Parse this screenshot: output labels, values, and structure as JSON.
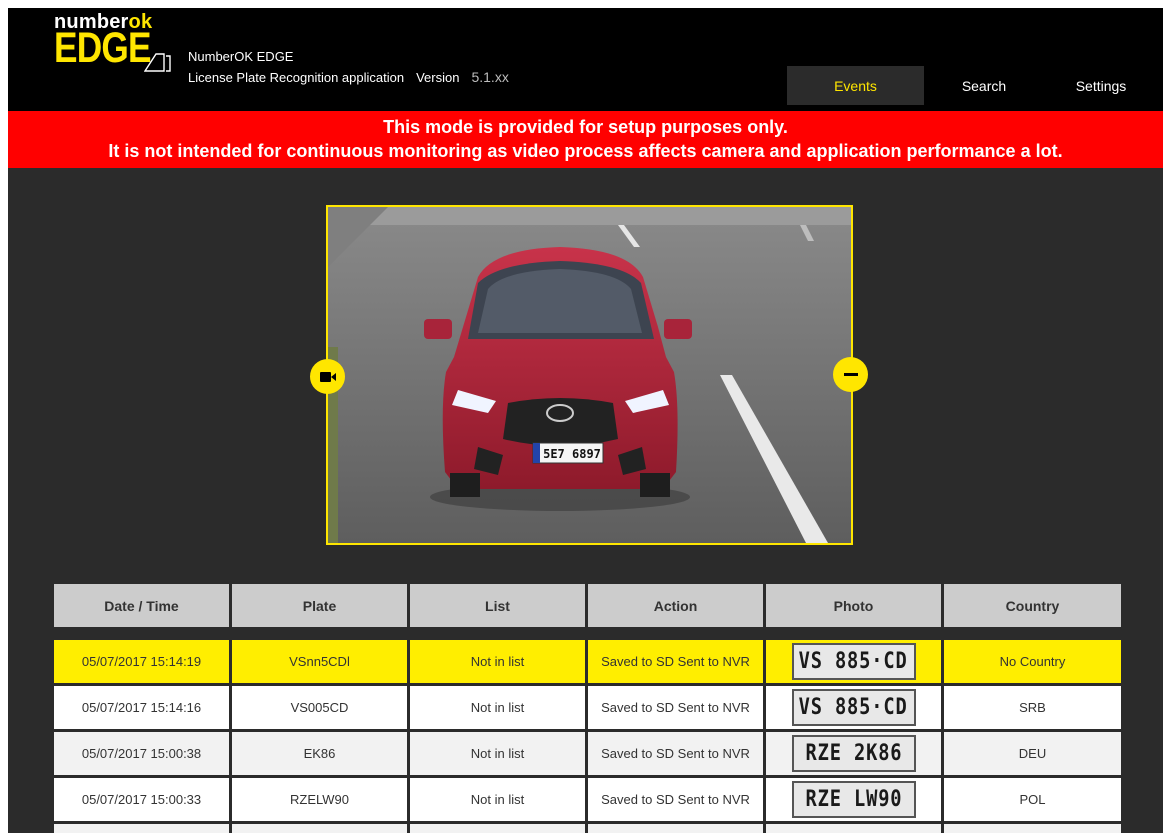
{
  "header": {
    "logo_word": "number",
    "logo_word_accent": "ok",
    "logo_product": "EDGE",
    "app_name": "NumberOK EDGE",
    "app_subtitle": "License Plate Recognition application",
    "version_label": "Version",
    "version_value": "5.1.xx",
    "nav": [
      {
        "label": "Events",
        "active": true
      },
      {
        "label": "Search",
        "active": false
      },
      {
        "label": "Settings",
        "active": false
      }
    ]
  },
  "banner": {
    "line1": "This mode is provided for setup purposes only.",
    "line2": "It is not intended for continuous monitoring as video process affects camera and application performance a lot."
  },
  "video": {
    "plate_text": "5E7 6897",
    "left_button_icon": "video-camera-icon",
    "right_button_icon": "minus-icon"
  },
  "table": {
    "columns": [
      "Date / Time",
      "Plate",
      "List",
      "Action",
      "Photo",
      "Country"
    ],
    "rows": [
      {
        "datetime": "05/07/2017 15:14:19",
        "plate": "VSnn5CDl",
        "list": "Not in list",
        "action": "Saved to SD Sent to NVR",
        "photo": "VS 885·CD",
        "country": "No Country",
        "selected": true
      },
      {
        "datetime": "05/07/2017 15:14:16",
        "plate": "VS005CD",
        "list": "Not in list",
        "action": "Saved to SD Sent to NVR",
        "photo": "VS 885·CD",
        "country": "SRB",
        "selected": false
      },
      {
        "datetime": "05/07/2017 15:00:38",
        "plate": "EK86",
        "list": "Not in list",
        "action": "Saved to SD Sent to NVR",
        "photo": "RZE 2K86",
        "country": "DEU",
        "selected": false
      },
      {
        "datetime": "05/07/2017 15:00:33",
        "plate": "RZELW90",
        "list": "Not in list",
        "action": "Saved to SD Sent to NVR",
        "photo": "RZE LW90",
        "country": "POL",
        "selected": false
      }
    ]
  },
  "colors": {
    "accent": "#ffe600",
    "banner": "#ff0000",
    "background": "#2b2b2b",
    "header": "#000000",
    "table_header": "#cccccc"
  }
}
